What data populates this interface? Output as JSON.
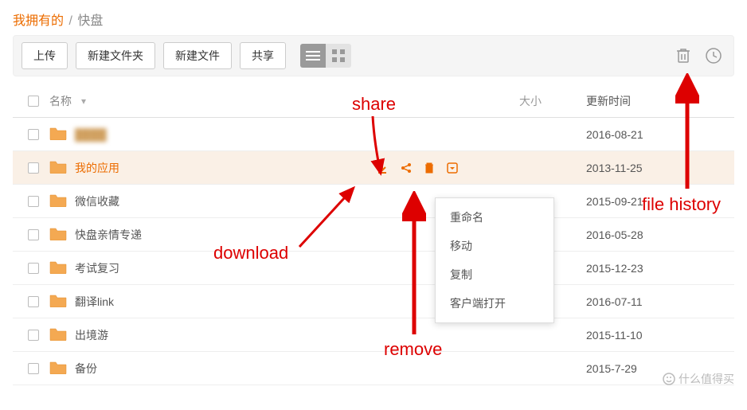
{
  "breadcrumb": {
    "root": "我拥有的",
    "sep": "/",
    "current": "快盘"
  },
  "toolbar": {
    "upload": "上传",
    "new_folder": "新建文件夹",
    "new_file": "新建文件",
    "share": "共享"
  },
  "columns": {
    "name": "名称",
    "size": "大小",
    "updated": "更新时间"
  },
  "rows": [
    {
      "name": "████",
      "date": "2016-08-21",
      "blur": true
    },
    {
      "name": "我的应用",
      "date": "2013-11-25",
      "hover": true
    },
    {
      "name": "微信收藏",
      "date": "2015-09-21"
    },
    {
      "name": "快盘亲情专递",
      "date": "2016-05-28"
    },
    {
      "name": "考试复习",
      "date": "2015-12-23"
    },
    {
      "name": "翻译link",
      "date": "2016-07-11"
    },
    {
      "name": "出境游",
      "date": "2015-11-10"
    },
    {
      "name": "备份",
      "date": "2015-7-29"
    }
  ],
  "context_menu": [
    "重命名",
    "移动",
    "复制",
    "客户端打开"
  ],
  "annotations": {
    "share": "share",
    "download": "download",
    "remove": "remove",
    "history": "file history"
  },
  "watermark": "什么值得买"
}
